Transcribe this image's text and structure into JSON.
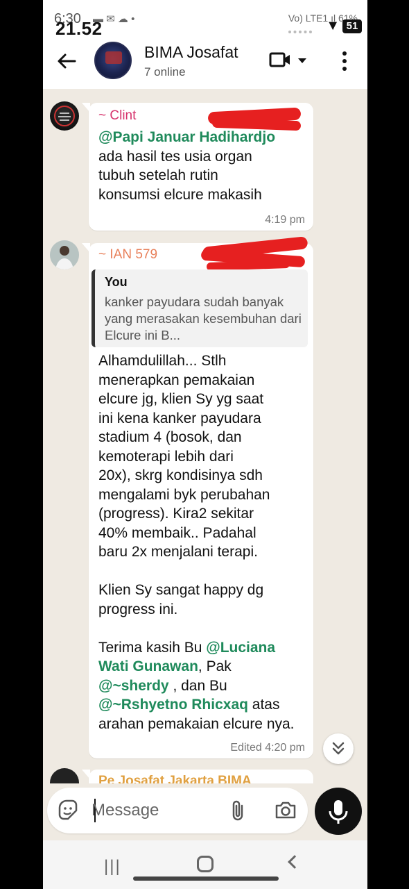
{
  "status_bar": {
    "back_time": "6:30",
    "time": "21.52",
    "left_icons": "▬ ✉ ☁ •",
    "right_info": "Vo) LTE1 ıl 61%",
    "battery": "51"
  },
  "header": {
    "title": "BIMA Josafat",
    "subtitle": "7 online"
  },
  "messages": [
    {
      "sender": "~ Clint",
      "sender_color": "#d6336c",
      "mention": "@Papi Januar Hadihardjo",
      "text": "ada hasil tes usia organ tubuh setelah rutin konsumsi elcure makasih",
      "time": "4:19 pm"
    },
    {
      "sender": "~ IAN 579",
      "sender_color": "#e8805a",
      "quote": {
        "author": "You",
        "text": "kanker payudara sudah banyak yang merasakan kesembuhan dari Elcure ini B..."
      },
      "body_lines": [
        "Alhamdulillah... Stlh",
        "menerapkan pemakaian",
        "elcure jg, klien Sy yg saat",
        "ini kena kanker payudara",
        "stadium 4 (bosok, dan",
        "kemoterapi lebih dari",
        "20x), skrg kondisinya sdh",
        "mengalami byk perubahan",
        "(progress). Kira2 sekitar",
        "40% membaik.. Padahal",
        "baru 2x menjalani terapi."
      ],
      "body2": "Klien Sy sangat happy dg progress ini.",
      "thanks": {
        "p1": "Terima kasih Bu ",
        "m1": "@Luciana Wati Gunawan",
        "p2": ", Pak ",
        "m2": "@~sherdy",
        "p3": " , dan Bu ",
        "m3": "@~Rshyetno Rhicxaq",
        "p4": " atas arahan pemakaian elcure nya."
      },
      "time": "Edited 4:20 pm"
    },
    {
      "sender": "Pe Josafat Jakarta BIMA",
      "sender_color": "#e0a040"
    }
  ],
  "input": {
    "placeholder": "Message"
  },
  "colors": {
    "mention": "#1f8a5b",
    "chat_bg": "#efeae2",
    "redaction": "#e62020"
  },
  "icons": [
    "back-arrow-icon",
    "video-call-icon",
    "more-options-icon",
    "emoji-sticker-icon",
    "attach-icon",
    "camera-icon",
    "mic-icon",
    "scroll-down-icon"
  ]
}
